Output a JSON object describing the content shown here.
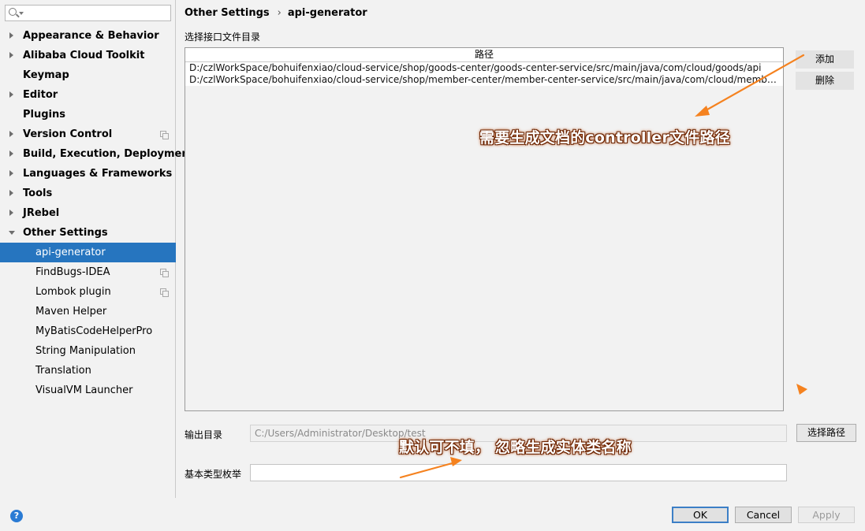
{
  "sidebar": {
    "items": [
      {
        "label": "Appearance & Behavior",
        "level": "top",
        "expander": "collapsed",
        "copy_icon": false
      },
      {
        "label": "Alibaba Cloud Toolkit",
        "level": "top",
        "expander": "collapsed",
        "copy_icon": false
      },
      {
        "label": "Keymap",
        "level": "top",
        "expander": "none",
        "copy_icon": false
      },
      {
        "label": "Editor",
        "level": "top",
        "expander": "collapsed",
        "copy_icon": false
      },
      {
        "label": "Plugins",
        "level": "top",
        "expander": "none",
        "copy_icon": false
      },
      {
        "label": "Version Control",
        "level": "top",
        "expander": "collapsed",
        "copy_icon": true
      },
      {
        "label": "Build, Execution, Deployment",
        "level": "top",
        "expander": "collapsed",
        "copy_icon": false
      },
      {
        "label": "Languages & Frameworks",
        "level": "top",
        "expander": "collapsed",
        "copy_icon": false
      },
      {
        "label": "Tools",
        "level": "top",
        "expander": "collapsed",
        "copy_icon": false
      },
      {
        "label": "JRebel",
        "level": "top",
        "expander": "collapsed",
        "copy_icon": false
      },
      {
        "label": "Other Settings",
        "level": "top",
        "expander": "expanded",
        "copy_icon": false
      },
      {
        "label": "api-generator",
        "level": "child",
        "expander": "none",
        "copy_icon": false,
        "selected": true
      },
      {
        "label": "FindBugs-IDEA",
        "level": "child",
        "expander": "none",
        "copy_icon": true
      },
      {
        "label": "Lombok plugin",
        "level": "child",
        "expander": "none",
        "copy_icon": true
      },
      {
        "label": "Maven Helper",
        "level": "child",
        "expander": "none",
        "copy_icon": false
      },
      {
        "label": "MyBatisCodeHelperPro",
        "level": "child",
        "expander": "none",
        "copy_icon": false
      },
      {
        "label": "String Manipulation",
        "level": "child",
        "expander": "none",
        "copy_icon": false
      },
      {
        "label": "Translation",
        "level": "child",
        "expander": "none",
        "copy_icon": false
      },
      {
        "label": "VisualVM Launcher",
        "level": "child",
        "expander": "none",
        "copy_icon": false
      }
    ]
  },
  "breadcrumb": {
    "parent": "Other Settings",
    "separator": "›",
    "current": "api-generator"
  },
  "main": {
    "section_label": "选择接口文件目录",
    "table": {
      "header": "路径",
      "rows": [
        "D:/czlWorkSpace/bohuifenxiao/cloud-service/shop/goods-center/goods-center-service/src/main/java/com/cloud/goods/api",
        "D:/czlWorkSpace/bohuifenxiao/cloud-service/shop/member-center/member-center-service/src/main/java/com/cloud/member/..."
      ]
    },
    "add_button": "添加",
    "delete_button": "删除",
    "output_dir_label": "输出目录",
    "output_dir_value": "C:/Users/Administrator/Desktop/test",
    "choose_path_button": "选择路径",
    "enum_label": "基本类型枚举",
    "enum_value": ""
  },
  "annotations": {
    "top": "需要生成文档的controller文件路径",
    "bottom": "默认可不填， 忽略生成实体类名称",
    "color": "#f5821f"
  },
  "footer": {
    "help_icon": "?",
    "ok": "OK",
    "cancel": "Cancel",
    "apply": "Apply"
  },
  "colors": {
    "selection": "#2675bf",
    "background": "#f2f2f2",
    "help_icon": "#2a7bd4"
  }
}
